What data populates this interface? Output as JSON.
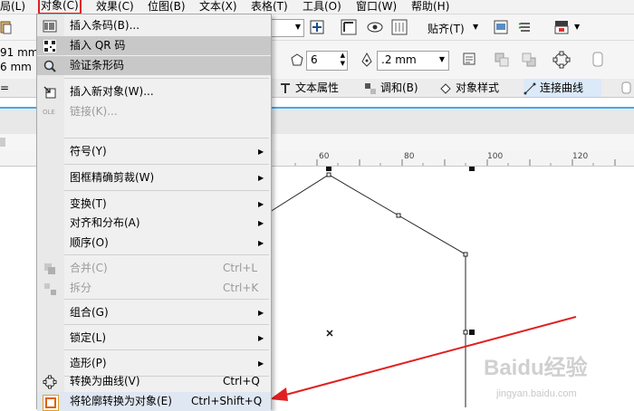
{
  "menubar": {
    "items": [
      "局(L)",
      "对象(C)",
      "效果(C)",
      "位图(B)",
      "文本(X)",
      "表格(T)",
      "工具(O)",
      "窗口(W)",
      "帮助(H)"
    ]
  },
  "toolbar": {
    "align_label": "贴齐(T)",
    "coord_x": "91 mm",
    "coord_y": "6 mm",
    "sides_value": "6",
    "outline_value": ".2 mm"
  },
  "tabs": {
    "text_props": "文本属性",
    "blend": "调和(B)",
    "obj_style": "对象样式",
    "connector": "连接曲线"
  },
  "ruler": {
    "labels": [
      "60",
      "80",
      "100",
      "120"
    ]
  },
  "menu": {
    "items": [
      {
        "label": "插入条码(B)...",
        "shortcut": ""
      },
      {
        "label": "插入 QR 码",
        "shortcut": ""
      },
      {
        "label": "验证条形码",
        "shortcut": ""
      },
      {
        "label": "插入新对象(W)...",
        "shortcut": ""
      },
      {
        "label": "链接(K)...",
        "shortcut": ""
      },
      {
        "label": "符号(Y)",
        "shortcut": ""
      },
      {
        "label": "图框精确剪裁(W)",
        "shortcut": ""
      },
      {
        "label": "变换(T)",
        "shortcut": ""
      },
      {
        "label": "对齐和分布(A)",
        "shortcut": ""
      },
      {
        "label": "顺序(O)",
        "shortcut": ""
      },
      {
        "label": "合并(C)",
        "shortcut": "Ctrl+L"
      },
      {
        "label": "拆分",
        "shortcut": "Ctrl+K"
      },
      {
        "label": "组合(G)",
        "shortcut": ""
      },
      {
        "label": "锁定(L)",
        "shortcut": ""
      },
      {
        "label": "造形(P)",
        "shortcut": ""
      },
      {
        "label": "转换为曲线(V)",
        "shortcut": "Ctrl+Q"
      },
      {
        "label": "将轮廓转换为对象(E)",
        "shortcut": "Ctrl+Shift+Q"
      }
    ]
  },
  "watermark": {
    "brand": "Baidu经验",
    "url": "jingyan.baidu.com"
  },
  "colors": {
    "highlight": "#c8c8c8",
    "annotation_red": "#e02020",
    "tab_accent": "#3fa9f5"
  }
}
